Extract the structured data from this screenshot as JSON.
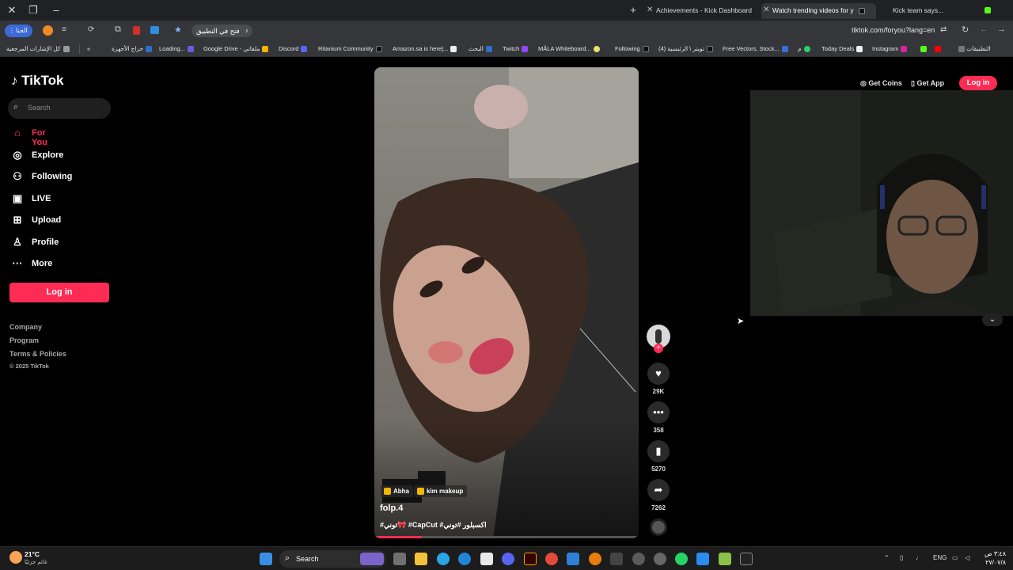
{
  "browser": {
    "tabs": [
      {
        "title": "Achievements - Kick Dashboard",
        "active": false
      },
      {
        "title": "Watch trending videos for y",
        "active": true
      },
      {
        "title": "Kick team says...",
        "active": false
      }
    ],
    "profile_label": "الحنا",
    "open_in_app_label": "فتح في التطبيق",
    "url": "tiktok.com/foryou?lang=en",
    "bookmarks": [
      "كل الإشارات المرجعية",
      "حراج الأجهزة",
      "Loading...",
      "Google Drive - ملفاتي",
      "Discord",
      "Ritanium Community",
      "Amazon.sa is here|...",
      "البحث",
      "Twitch",
      "MÅLA Whiteboard...",
      "Following",
      "(4) تويتر \\ الرئيسية",
      "Free Vectors, Stock...",
      "م",
      "Today Deals",
      "Instagram",
      "التطبيقات"
    ]
  },
  "tiktok": {
    "brand": "TikTok",
    "search_placeholder": "Search",
    "nav": [
      {
        "label": "For You",
        "icon": "home-icon",
        "active": true
      },
      {
        "label": "Explore",
        "icon": "compass-icon",
        "active": false
      },
      {
        "label": "Following",
        "icon": "following-icon",
        "active": false
      },
      {
        "label": "LIVE",
        "icon": "live-icon",
        "active": false
      },
      {
        "label": "Upload",
        "icon": "upload-icon",
        "active": false
      },
      {
        "label": "Profile",
        "icon": "profile-icon",
        "active": false
      },
      {
        "label": "More",
        "icon": "more-icon",
        "active": false
      }
    ],
    "login_label": "Log in",
    "footer": {
      "company": "Company",
      "program": "Program",
      "terms": "Terms & Policies",
      "copyright": "© 2025 TikTok"
    },
    "top_actions": {
      "get_coins": "Get Coins",
      "get_app": "Get App",
      "login": "Log in"
    },
    "video": {
      "tags": [
        "Abha",
        "kim makeup"
      ],
      "author": "folp.4",
      "caption": "#توني🎀 #CapCut #اكسبلور #توني",
      "progress_fraction": 0.18
    },
    "actions": {
      "likes": "29K",
      "comments": "358",
      "saves": "5270",
      "shares": "7262"
    }
  },
  "taskbar": {
    "weather_temp": "21°C",
    "weather_desc": "غائم جزئيًا",
    "search_label": "Search",
    "lang": "ENG",
    "time": "٣:٤٨ ص",
    "date": "٢٧/٠٧/٨"
  },
  "colors": {
    "accent": "#fe2c55",
    "chrome_dark": "#202124",
    "chrome_mid": "#35363a"
  }
}
